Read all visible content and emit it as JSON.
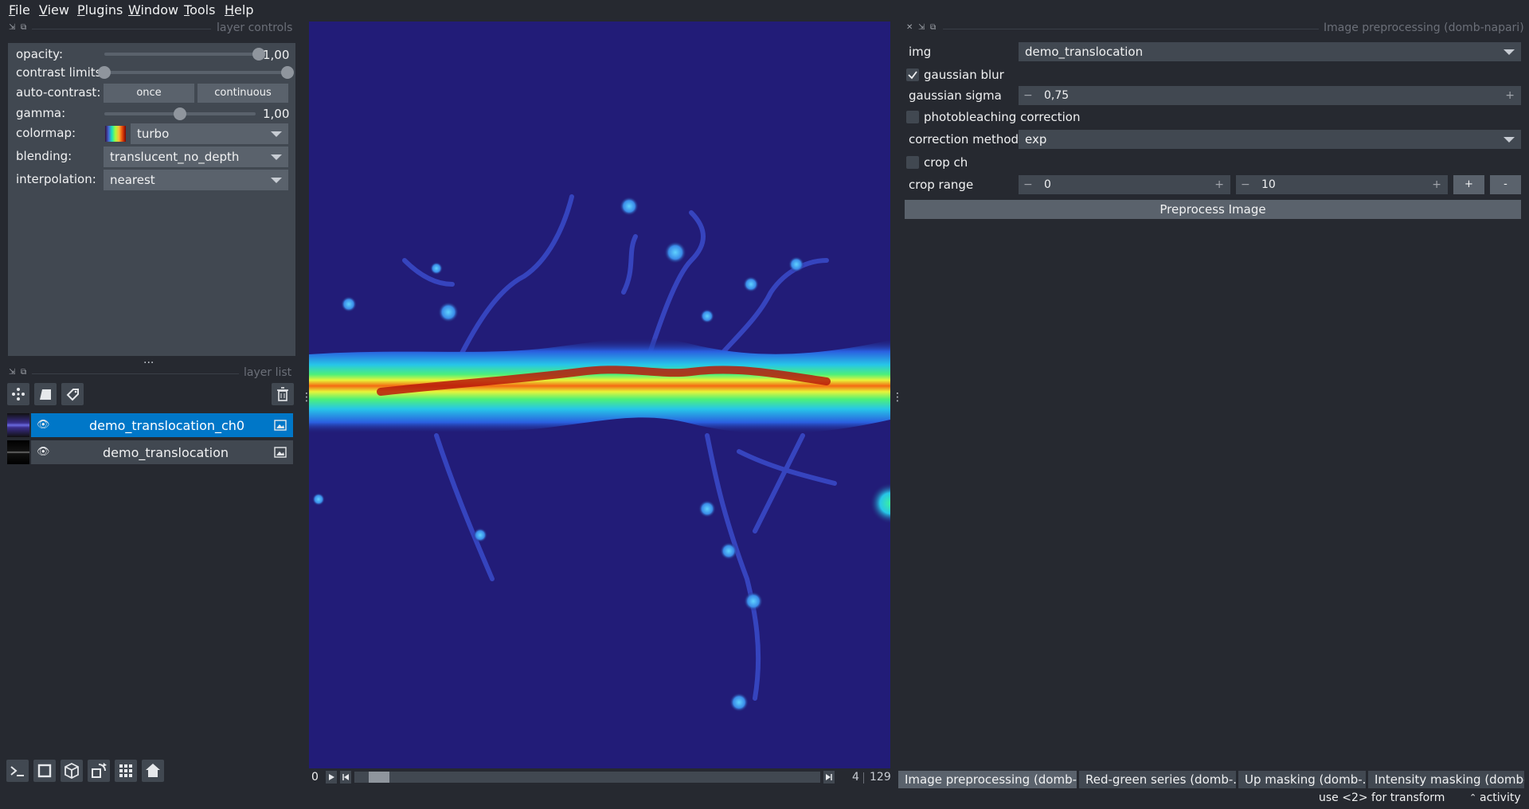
{
  "menubar": {
    "items": [
      {
        "prefix": "F",
        "rest": "ile"
      },
      {
        "prefix": "V",
        "rest": "iew"
      },
      {
        "prefix": "P",
        "rest": "lugins"
      },
      {
        "prefix": "W",
        "rest": "indow"
      },
      {
        "prefix": "T",
        "rest": "ools"
      },
      {
        "prefix": "H",
        "rest": "elp"
      }
    ]
  },
  "layer_controls": {
    "title": "layer controls",
    "opacity": {
      "label": "opacity:",
      "value": "1,00",
      "level": 1.0
    },
    "contrast_limits": {
      "label": "contrast limits:",
      "low": 0.0,
      "high": 1.0
    },
    "auto_contrast": {
      "label": "auto-contrast:",
      "once": "once",
      "continuous": "continuous"
    },
    "gamma": {
      "label": "gamma:",
      "value": "1,00",
      "level": 0.5
    },
    "colormap": {
      "label": "colormap:",
      "value": "turbo"
    },
    "blending": {
      "label": "blending:",
      "value": "translucent_no_depth"
    },
    "interpolation": {
      "label": "interpolation:",
      "value": "nearest"
    },
    "splitter": "..."
  },
  "layer_list": {
    "title": "layer list",
    "layers": [
      {
        "name": "demo_translocation_ch0",
        "selected": true
      },
      {
        "name": "demo_translocation",
        "selected": false
      }
    ]
  },
  "viewer": {
    "frame_index": "0",
    "slider_level": 0.03,
    "current_frame": "4",
    "total_frames": "129"
  },
  "plugin": {
    "title": "Image preprocessing (domb-napari)",
    "img_label": "img",
    "img_value": "demo_translocation",
    "gaussian_blur_label": "gaussian blur",
    "gaussian_blur_checked": true,
    "gaussian_sigma_label": "gaussian sigma",
    "gaussian_sigma_value": "0,75",
    "photobleaching_label": "photobleaching correction",
    "photobleaching_checked": false,
    "correction_method_label": "correction method",
    "correction_method_value": "exp",
    "crop_ch_label": "crop ch",
    "crop_ch_checked": false,
    "crop_range_label": "crop range",
    "crop_range_low": "0",
    "crop_range_high": "10",
    "plus_label": "+",
    "minus_label": "-",
    "preprocess_button": "Preprocess Image"
  },
  "dock_tabs": [
    "Image preprocessing (domb-...",
    "Red-green series (domb-...",
    "Up masking (domb-...",
    "Intensity masking (domb-..."
  ],
  "status_bar": {
    "hint": "use <2> for transform",
    "activity": "activity"
  },
  "colors": {
    "background": "#262930",
    "panel": "#414851",
    "accent": "#0077c8",
    "canvas_bg": "#1f1a6e"
  }
}
